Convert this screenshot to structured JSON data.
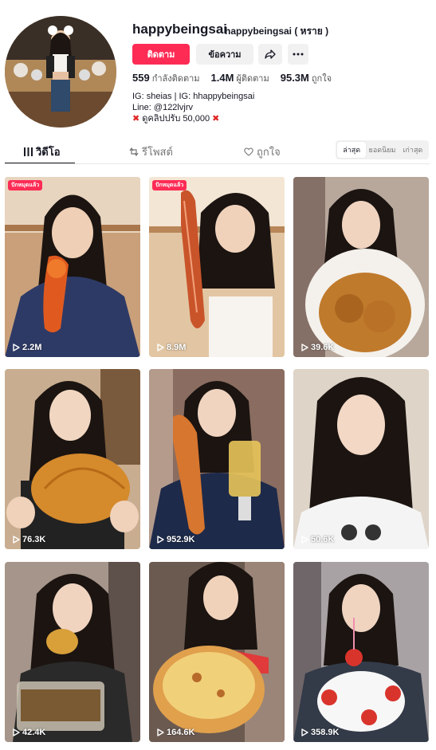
{
  "profile": {
    "username": "happybeingsai",
    "nickname": "happybeingsai ( หราย )",
    "follow_label": "ติดตาม",
    "message_label": "ข้อความ",
    "stats": [
      {
        "value": "559",
        "label": "กำลังติดตาม"
      },
      {
        "value": "1.4M",
        "label": "ผู้ติดตาม"
      },
      {
        "value": "95.3M",
        "label": "ถูกใจ"
      }
    ],
    "bio": [
      "IG: sheias | IG: hhappybeingsai",
      "Line: @122lvjrv",
      "ดูคลิปปรับ 50,000"
    ]
  },
  "tabs": [
    {
      "label": "วิดีโอ",
      "icon": "grid-icon"
    },
    {
      "label": "รีโพสต์",
      "icon": "repost-icon"
    },
    {
      "label": "ถูกใจ",
      "icon": "heart-lock-icon"
    }
  ],
  "sort": {
    "options": [
      "ล่าสุด",
      "ยอดนิยม",
      "เก่าสุด"
    ],
    "selected": "ล่าสุด"
  },
  "videos": [
    {
      "views": "2.2M",
      "pinned": "ปักหมุดแล้ว",
      "bg": "#c48a5a"
    },
    {
      "views": "8.9M",
      "pinned": "ปักหมุดแล้ว",
      "bg": "#d9b38c"
    },
    {
      "views": "39.6K",
      "bg": "#b9a497"
    },
    {
      "views": "76.3K",
      "bg": "#b49477"
    },
    {
      "views": "952.9K",
      "bg": "#8d6e62"
    },
    {
      "views": "50.6K",
      "bg": "#d8cfc4"
    },
    {
      "views": "42.4K",
      "bg": "#9c8b7f"
    },
    {
      "views": "164.6K",
      "bg": "#7e6a5e"
    },
    {
      "views": "358.9K",
      "bg": "#a9a3a6"
    }
  ]
}
